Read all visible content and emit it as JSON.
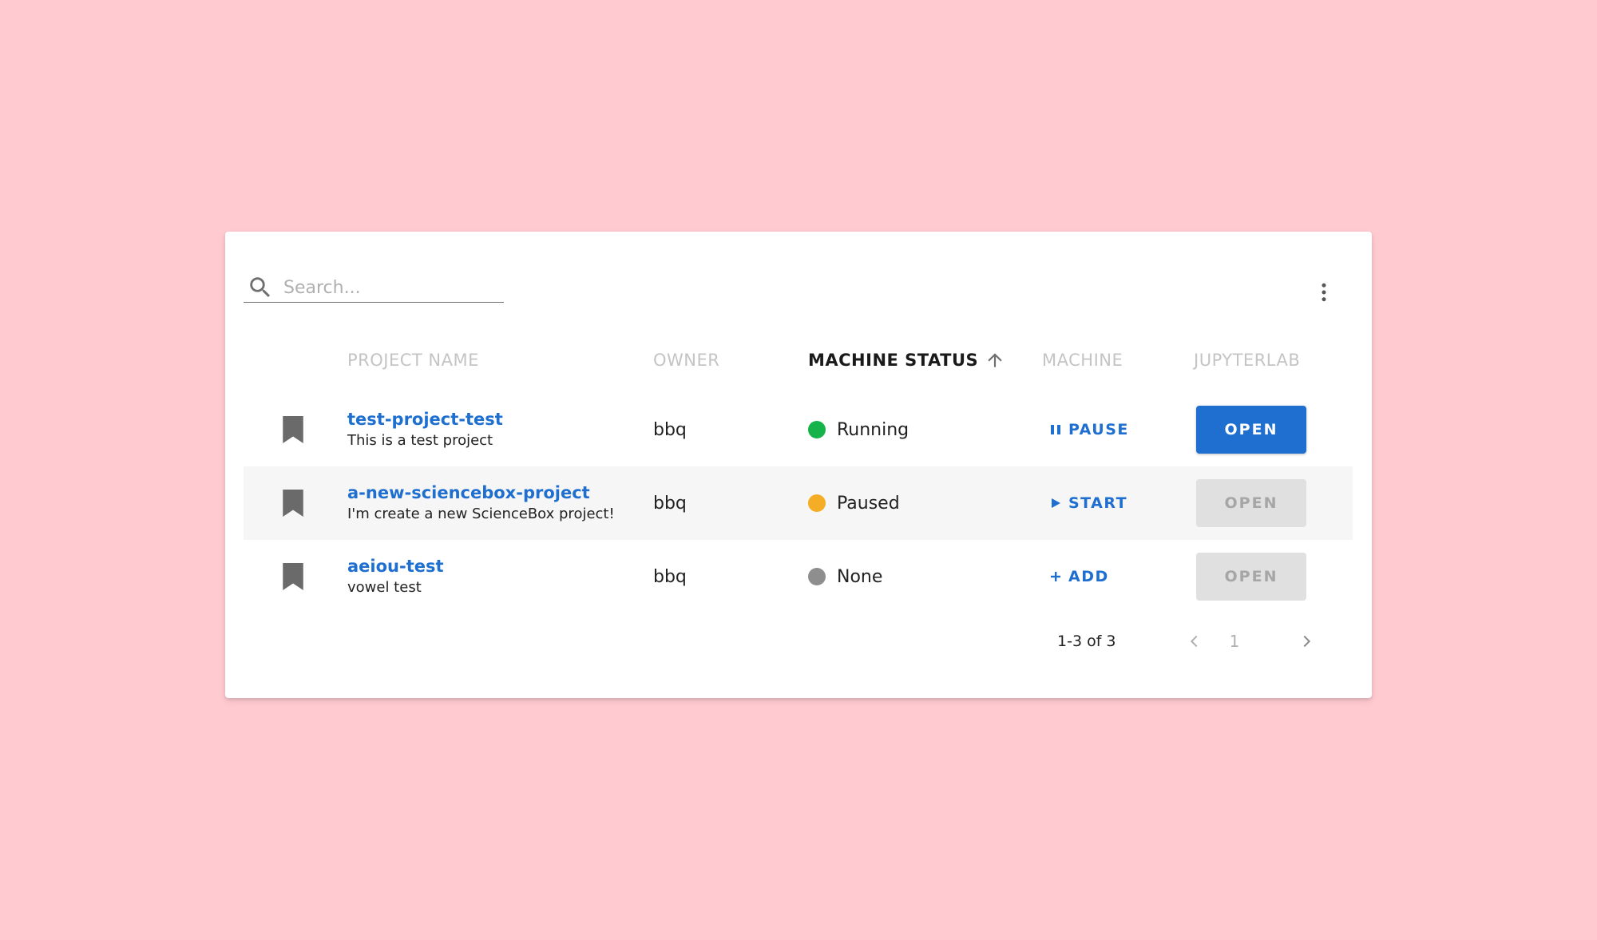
{
  "colors": {
    "background": "#ffcbd1",
    "accent": "#1e6fcf",
    "status_running": "#16b24a",
    "status_paused": "#f6ad26",
    "status_none": "#8e8e8e"
  },
  "search": {
    "placeholder": "Search...",
    "value": "",
    "icon": "search-icon"
  },
  "toolbar": {
    "more_icon": "more-vertical-icon"
  },
  "table": {
    "headers": {
      "project_name": "PROJECT NAME",
      "owner": "OWNER",
      "machine_status": "MACHINE STATUS",
      "machine": "MACHINE",
      "jupyterlab": "JUPYTERLAB"
    },
    "sort": {
      "column": "machine_status",
      "direction": "ascending",
      "icon": "arrow-up-icon"
    },
    "rows": [
      {
        "name": "test-project-test",
        "description": "This is a test project",
        "owner": "bbq",
        "status": "Running",
        "status_color": "#16b24a",
        "machine_action": "PAUSE",
        "machine_icon": "pause-icon",
        "open_label": "OPEN",
        "open_enabled": true
      },
      {
        "name": "a-new-sciencebox-project",
        "description": "I'm create a new ScienceBox project!",
        "owner": "bbq",
        "status": "Paused",
        "status_color": "#f6ad26",
        "machine_action": "START",
        "machine_icon": "play-icon",
        "open_label": "OPEN",
        "open_enabled": false
      },
      {
        "name": "aeiou-test",
        "description": "vowel test",
        "owner": "bbq",
        "status": "None",
        "status_color": "#8e8e8e",
        "machine_action": "ADD",
        "machine_icon": "plus-icon",
        "open_label": "OPEN",
        "open_enabled": false
      }
    ]
  },
  "pagination": {
    "range": "1-3 of 3",
    "current_page": "1"
  }
}
